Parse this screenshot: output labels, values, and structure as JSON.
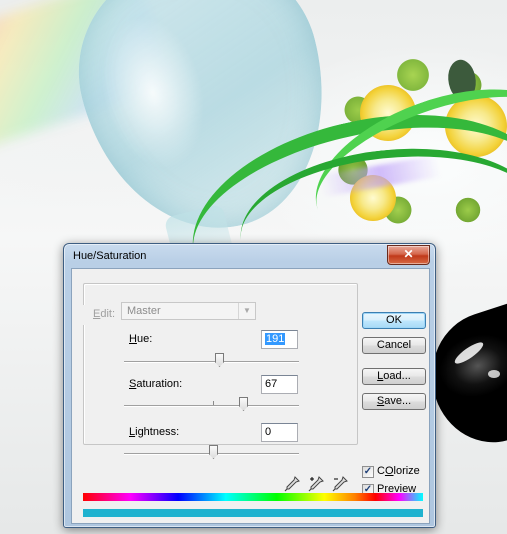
{
  "dialog": {
    "title": "Hue/Saturation",
    "close_glyph": "✕",
    "edit": {
      "label_underlined": "E",
      "label_rest": "dit:",
      "value": "Master"
    },
    "hue": {
      "label_underlined": "H",
      "label_rest": "ue:",
      "value": "191",
      "slider_fraction": 0.53
    },
    "saturation": {
      "label_underlined": "S",
      "label_rest": "aturation:",
      "value": "67",
      "slider_fraction": 0.67
    },
    "lightness": {
      "label_underlined": "L",
      "label_rest": "ightness:",
      "value": "0",
      "slider_fraction": 0.5
    },
    "buttons": {
      "ok": "OK",
      "cancel": "Cancel",
      "load_underlined": "L",
      "load_rest": "oad...",
      "save_underlined": "S",
      "save_rest": "ave..."
    },
    "colorize": {
      "label_underlined": "O",
      "label_before": "C",
      "label_rest": "lorize",
      "checked": true
    },
    "preview": {
      "label_underlined": "P",
      "label_rest": "review",
      "checked": true
    },
    "eyedroppers": [
      "eyedropper-icon",
      "eyedropper-plus-icon",
      "eyedropper-minus-icon"
    ],
    "result_bar_color": "#1fb2cf"
  }
}
